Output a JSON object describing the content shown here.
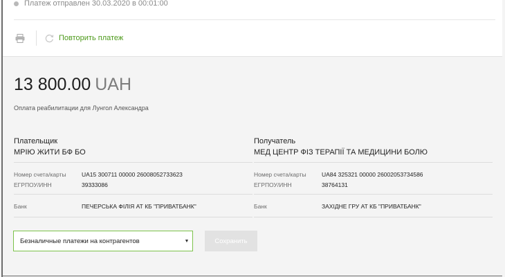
{
  "status": {
    "text": "Платеж отправлен 30.03.2020 в 00:01:00"
  },
  "actions": {
    "print_icon": "printer-icon",
    "repeat_icon": "refresh-icon",
    "repeat_label": "Повторить платеж"
  },
  "payment": {
    "amount": "13 800.00",
    "currency": "UAH",
    "purpose": "Оплата реабилитации для Лунгол Александра"
  },
  "payer": {
    "heading": "Плательщик",
    "name": "МРІЮ ЖИТИ БФ БО",
    "account_label": "Номер счета/карты",
    "account_value": "UA15 300711 00000 26008052733623",
    "tax_label": "ЕГРПОУ/ИНН",
    "tax_value": "39333086",
    "bank_label": "Банк",
    "bank_value": "ПЕЧЕРСЬКА ФІЛІЯ АТ КБ \"ПРИВАТБАНК\""
  },
  "receiver": {
    "heading": "Получатель",
    "name": "МЕД ЦЕНТР ФІЗ ТЕРАПІЇ ТА МЕДИЦИНИ БОЛЮ",
    "account_label": "Номер счета/карты",
    "account_value": "UA84 325321 00000 26002053734586",
    "tax_label": "ЕГРПОУ/ИНН",
    "tax_value": "38764131",
    "bank_label": "Банк",
    "bank_value": "ЗАХІДНЕ ГРУ АТ КБ \"ПРИВАТБАНК\""
  },
  "category_select": {
    "selected": "Безналичные платежи на контрагентов",
    "caret_icon": "caret-down-icon"
  },
  "save_button": {
    "label": "Сохранить"
  },
  "colors": {
    "accent_green": "#4e9a1c",
    "select_border": "#7cc24a",
    "disabled_button": "#e2e2e2"
  }
}
